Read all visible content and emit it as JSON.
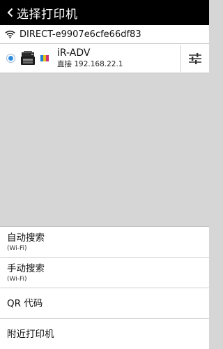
{
  "header": {
    "title": "选择打印机",
    "back_icon": "chevron-left-icon"
  },
  "network": {
    "icon": "wifi-icon",
    "name": "DIRECT-e9907e6cfe66df83"
  },
  "printer": {
    "selected": true,
    "icon": "printer-icon",
    "color_icon": "color-printer-icon",
    "name": "iR-ADV",
    "address": "直接 192.168.22.1",
    "settings_icon": "sliders-icon"
  },
  "menu": {
    "items": [
      {
        "label": "自动搜索",
        "sub": "(Wi-Fi)"
      },
      {
        "label": "手动搜索",
        "sub": "(Wi-Fi)"
      },
      {
        "label": "QR 代码"
      },
      {
        "label": "附近打印机"
      }
    ]
  },
  "colors": {
    "title_bg": "#000000",
    "list_bg": "#d6d6d6",
    "radio_accent": "#2f8de0",
    "color_bar": [
      "#1f7fd1",
      "#e0c21c",
      "#d12d70"
    ]
  }
}
